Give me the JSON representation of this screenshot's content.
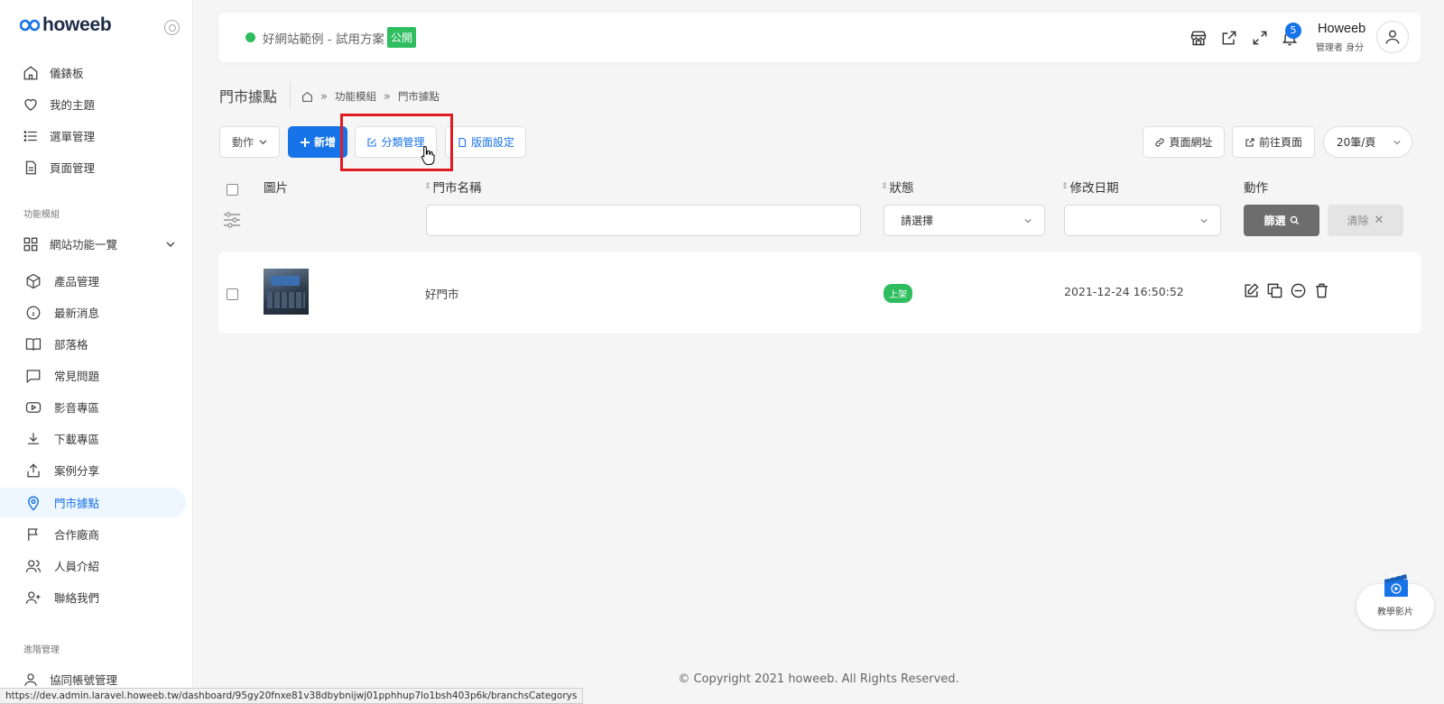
{
  "app": {
    "logo_text": "howeeb"
  },
  "sidebar": {
    "top_items": [
      {
        "label": "儀錶板"
      },
      {
        "label": "我的主題"
      },
      {
        "label": "選單管理"
      },
      {
        "label": "頁面管理"
      }
    ],
    "section_modules": "功能模組",
    "features_group": "網站功能一覽",
    "module_items": [
      {
        "label": "產品管理"
      },
      {
        "label": "最新消息"
      },
      {
        "label": "部落格"
      },
      {
        "label": "常見問題"
      },
      {
        "label": "影音專區"
      },
      {
        "label": "下載專區"
      },
      {
        "label": "案例分享"
      },
      {
        "label": "門市據點"
      },
      {
        "label": "合作廠商"
      },
      {
        "label": "人員介紹"
      },
      {
        "label": "聯絡我們"
      }
    ],
    "section_advanced": "進階管理",
    "advanced_items": [
      {
        "label": "協同帳號管理"
      }
    ]
  },
  "header": {
    "site_name": "好網站範例 - 試用方案",
    "public_label": "公開",
    "notification_count": "5",
    "user_name": "Howeeb",
    "user_role": "管理者 身分"
  },
  "page": {
    "title": "門市據點",
    "breadcrumb": [
      "功能模組",
      "門市據點"
    ]
  },
  "toolbar": {
    "action_label": "動作",
    "add_label": "新增",
    "category_label": "分類管理",
    "layout_label": "版面設定",
    "page_url_label": "頁面網址",
    "goto_page_label": "前往頁面",
    "per_page_label": "20筆/頁"
  },
  "table": {
    "columns": [
      "圖片",
      "門市名稱",
      "狀態",
      "修改日期",
      "動作"
    ],
    "status_placeholder": "請選擇",
    "filter_label": "篩選",
    "clear_label": "清除",
    "rows": [
      {
        "name": "好門市",
        "status": "上架",
        "modified": "2021-12-24 16:50:52"
      }
    ]
  },
  "footer": {
    "copyright": "© Copyright 2021 howeeb. All Rights Reserved."
  },
  "status_bar": {
    "url": "https://dev.admin.laravel.howeeb.tw/dashboard/95gy20fnxe81v38dbybnijwj01pphhup7lo1bsh403p6k/branchsCategorys"
  },
  "tutorial": {
    "label": "教學影片"
  },
  "colors": {
    "primary": "#1773e8",
    "success": "#2ebd5f",
    "highlight": "#e01b24"
  }
}
